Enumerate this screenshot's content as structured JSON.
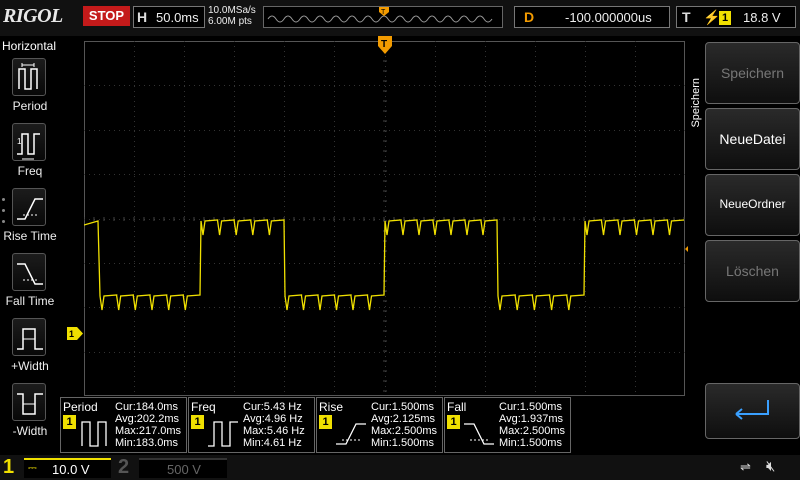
{
  "top": {
    "logo": "RIGOL",
    "run_state": "STOP",
    "horizontal_label": "H",
    "timebase": "50.0ms",
    "sample_rate": "10.0MSa/s",
    "memory_depth": "6.00M pts",
    "delay_label": "D",
    "delay_value": "-100.000000us",
    "trigger_label": "T",
    "trigger_edge": "⚡",
    "trigger_channel": "1",
    "trigger_level": "18.8 V"
  },
  "left_menu": {
    "title": "Horizontal",
    "items": [
      {
        "label": "Period",
        "icon": "period-icon"
      },
      {
        "label": "Freq",
        "icon": "frequency-icon"
      },
      {
        "label": "Rise Time",
        "icon": "rise-time-icon"
      },
      {
        "label": "Fall Time",
        "icon": "fall-time-icon"
      },
      {
        "label": "+Width",
        "icon": "positive-width-icon"
      },
      {
        "label": "-Width",
        "icon": "negative-width-icon"
      }
    ]
  },
  "right_menu": {
    "title": "Speichern",
    "buttons": [
      {
        "label": "Speichern",
        "enabled": false
      },
      {
        "label": "NeueDatei",
        "enabled": true
      },
      {
        "label": "NeueOrdner",
        "enabled": true
      },
      {
        "label": "Löschen",
        "enabled": false
      }
    ],
    "enter_icon": "enter-icon"
  },
  "markers": {
    "trigger_position": "T",
    "channel_marker": "1"
  },
  "measurements": [
    {
      "name": "Period",
      "channel": "1",
      "cur": "Cur:184.0ms",
      "avg": "Avg:202.2ms",
      "max": "Max:217.0ms",
      "min": "Min:183.0ms"
    },
    {
      "name": "Freq",
      "channel": "1",
      "cur": "Cur:5.43 Hz",
      "avg": "Avg:4.96 Hz",
      "max": "Max:5.46 Hz",
      "min": "Min:4.61 Hz"
    },
    {
      "name": "Rise",
      "channel": "1",
      "cur": "Cur:1.500ms",
      "avg": "Avg:2.125ms",
      "max": "Max:2.500ms",
      "min": "Min:1.500ms"
    },
    {
      "name": "Fall",
      "channel": "1",
      "cur": "Cur:1.500ms",
      "avg": "Avg:1.937ms",
      "max": "Max:2.500ms",
      "min": "Min:1.500ms"
    }
  ],
  "bottom": {
    "ch1_number": "1",
    "ch1_coupling": "⎓",
    "ch1_scale": "10.0 V",
    "ch2_number": "2",
    "ch2_scale": "500 V",
    "usb_icon": "usb-icon",
    "speaker_icon": "speaker-muted-icon"
  },
  "colors": {
    "trace": "#f0e000",
    "marker": "#f39b00",
    "stop": "#c41a1a",
    "grid": "#3a3a3a"
  }
}
